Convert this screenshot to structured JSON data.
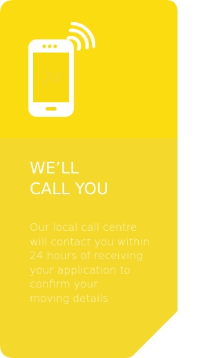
{
  "card": {
    "icon_name": "smartphone-signal-icon",
    "icon_number": "24",
    "heading_lines": [
      "WE’LL",
      "CALL YOU"
    ],
    "body_lines": [
      "Our local call centre",
      "will contact you within",
      "24 hours of receiving",
      "your application to",
      "confirm your",
      "moving details"
    ],
    "colors": {
      "top_panel": "#fbdc10",
      "bottom_panel": "#f4d82c",
      "text": "#ffffff"
    }
  }
}
